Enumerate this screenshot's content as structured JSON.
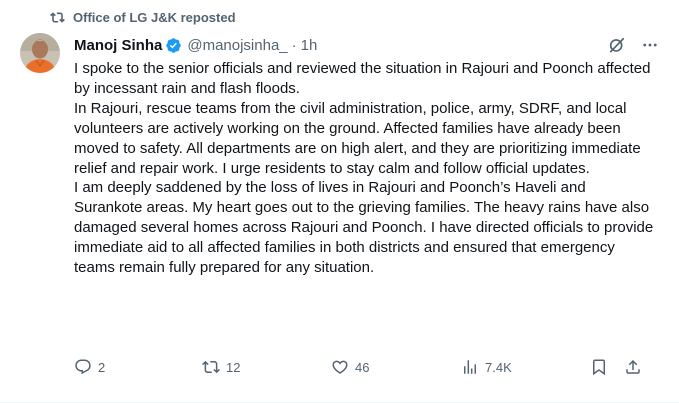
{
  "repost": {
    "label": "Office of LG J&K reposted"
  },
  "author": {
    "name": "Manoj Sinha",
    "handle": "@manojsinha_",
    "separator": "·",
    "time": "1h"
  },
  "body": {
    "paragraphs": [
      "I spoke to the senior officials and reviewed the situation in Rajouri and Poonch affected by incessant rain and flash floods.",
      "In Rajouri, rescue teams from the civil administration, police, army, SDRF, and local volunteers are actively working on the ground. Affected families have already been moved to safety. All departments are on high alert, and they are prioritizing immediate relief and repair work. I urge residents to stay calm and follow official updates.",
      "I am deeply saddened by the loss of lives in Rajouri and Poonch’s Haveli and Surankote areas. My heart goes out to the grieving families. The heavy rains have also damaged several homes across Rajouri and Poonch. I have directed officials to provide immediate aid to all affected families in both districts and ensured that emergency teams remain fully prepared for any situation."
    ]
  },
  "metrics": {
    "replies": "2",
    "reposts": "12",
    "likes": "46",
    "views": "7.4K"
  },
  "colors": {
    "text": "#0f1419",
    "muted": "#536471",
    "verified": "#1d9bf0"
  }
}
